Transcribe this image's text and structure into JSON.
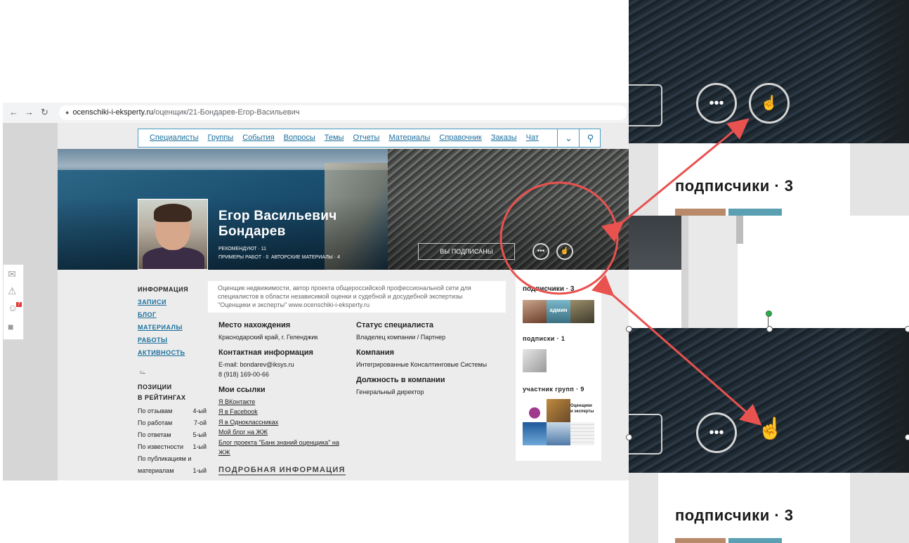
{
  "browser": {
    "back_icon": "arrow-left-icon",
    "forward_icon": "arrow-right-icon",
    "reload_icon": "reload-icon",
    "url_host": "ocenschiki-i-eksperty.ru",
    "url_path": "/оценщик/21-Бондарев-Егор-Васильевич"
  },
  "nav": {
    "items": [
      "Специалисты",
      "Группы",
      "События",
      "Вопросы",
      "Темы",
      "Отчеты",
      "Материалы",
      "Справочник",
      "Заказы",
      "Чат"
    ],
    "more_icon": "chevron-down-icon",
    "search_icon": "search-icon"
  },
  "profile": {
    "name_line1": "Егор Васильевич",
    "name_line2": "Бондарев",
    "recommend": "рекомендуют · 11",
    "works": "примеры работ · 0",
    "materials": "авторские материалы · 4",
    "subscribed_button": "ВЫ ПОДПИСАНЫ",
    "message_icon": "speech-bubble-icon",
    "like_icon": "thumbs-up-icon"
  },
  "left_nav": {
    "items": [
      "ИНФОРМАЦИЯ",
      "ЗАПИСИ",
      "БЛОГ",
      "МАТЕРИАЛЫ",
      "РАБОТЫ",
      "АКТИВНОСТЬ"
    ],
    "trophy_icon": "trophy-icon",
    "ranking_title_1": "ПОЗИЦИИ",
    "ranking_title_2": "В РЕЙТИНГАХ",
    "rankings": [
      {
        "label": "По отзывам",
        "value": "4-ый"
      },
      {
        "label": "По работам",
        "value": "7-ой"
      },
      {
        "label": "По ответам",
        "value": "5-ый"
      },
      {
        "label": "По известности",
        "value": "1-ый"
      },
      {
        "label": "По публикациям и",
        "value": ""
      },
      {
        "label": "материалам",
        "value": "1-ый"
      }
    ]
  },
  "about": {
    "line1": "Оценщик недвижимости, автор проекта общероссийской профессиональной сети для",
    "line2": "специалистов в области независимой оценки и судебной и досудебной экспертизы",
    "line3": "\"Оценщики и эксперты\" www.ocenschiki-i-eksperty.ru"
  },
  "info": {
    "location_h": "Место нахождения",
    "location": "Краснодарский край, г. Геленджик",
    "contact_h": "Контактная информация",
    "email": "E-mail: bondarev@iksys.ru",
    "phone": "8 (918) 169-00-66",
    "links_h": "Мои ссылки",
    "links": [
      "Я ВКонтакте",
      "Я в Facebook",
      "Я в Одноклассниках",
      "Мой блог на ЖЖ",
      "Блог проекта \"Банк знаний оценщика\" на",
      "ЖЖ"
    ],
    "status_h": "Статус специалиста",
    "status": "Владелец компании / Партнер",
    "company_h": "Компания",
    "company": "Интегрированные Консалтинговые Системы",
    "position_h": "Должность в компании",
    "position": "Генеральный директор",
    "more_h": "ПОДРОБНАЯ ИНФОРМАЦИЯ"
  },
  "right": {
    "subscribers": "подписчики · 3",
    "subscriptions": "подписки · 1",
    "groups": "участник групп · 9",
    "admin_label": "админ",
    "group_label_1": "Оценщики",
    "group_label_2": "и эксперты"
  },
  "sidebar": {
    "mail_icon": "envelope-icon",
    "bell_icon": "bell-icon",
    "users_icon": "users-icon",
    "badge": "7",
    "chat_icon": "chat-icon"
  },
  "zoom": {
    "subscribers_top": "подписчики · 3",
    "subscribers_bottom": "подписчики · 3"
  },
  "colors": {
    "accent": "#1b6f9c",
    "annotation": "#e8524f"
  }
}
